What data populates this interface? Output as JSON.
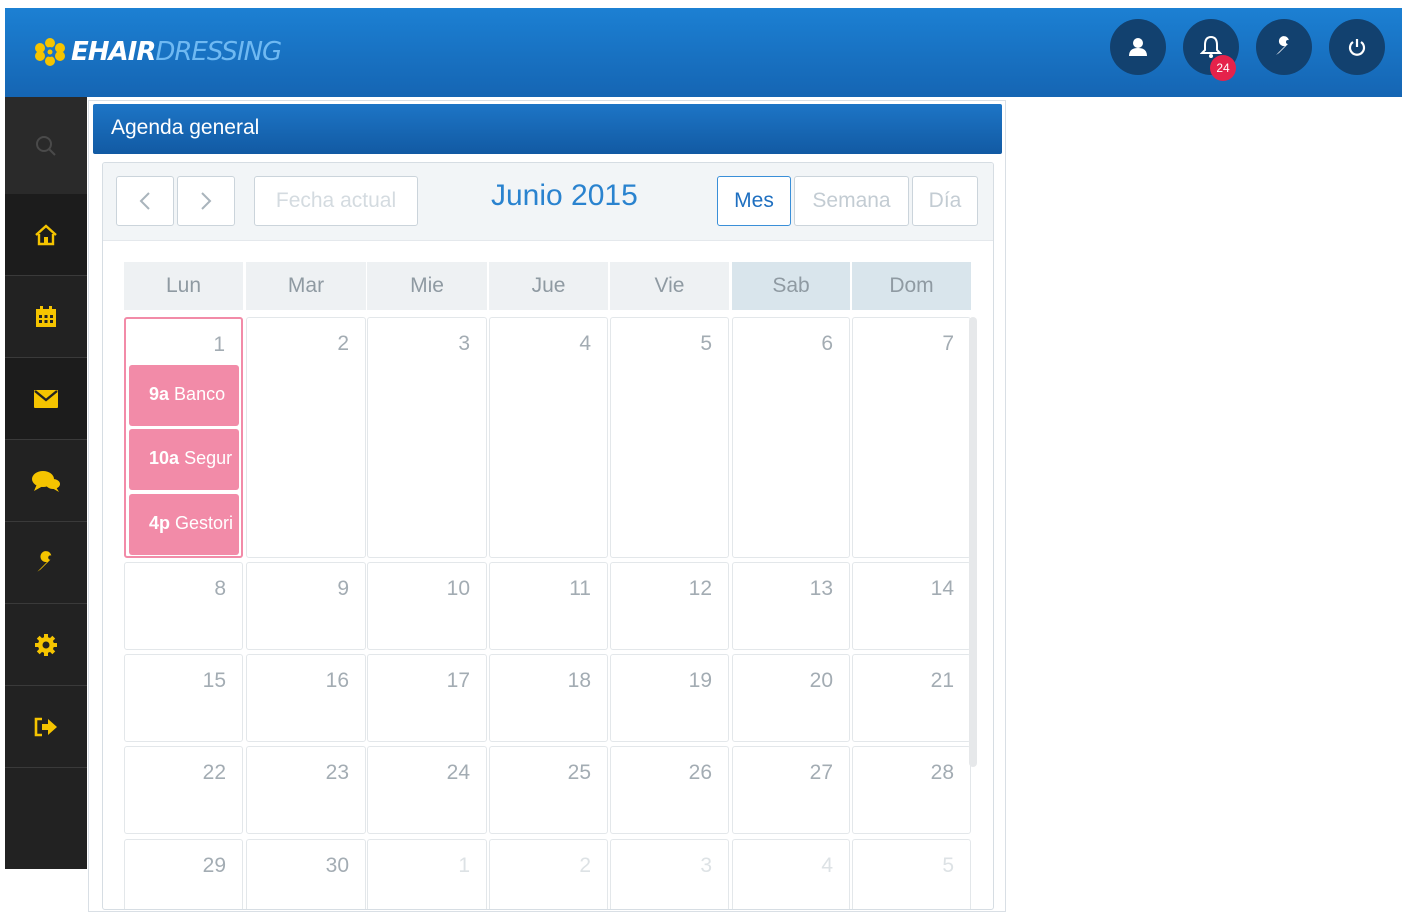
{
  "brand": {
    "part1": "EHAIR",
    "part2": "DRESSING",
    "mark_color": "#f5c400"
  },
  "header": {
    "icons": [
      {
        "name": "user-icon"
      },
      {
        "name": "bell-icon",
        "badge": "24"
      },
      {
        "name": "wrench-icon"
      },
      {
        "name": "power-icon"
      }
    ]
  },
  "sidebar": {
    "items": [
      {
        "name": "home-icon"
      },
      {
        "name": "calendar-icon"
      },
      {
        "name": "envelope-icon"
      },
      {
        "name": "chat-icon"
      },
      {
        "name": "wrench-icon"
      },
      {
        "name": "cog-icon"
      },
      {
        "name": "logout-icon"
      }
    ],
    "icon_color": "#f5c400"
  },
  "panel": {
    "title": "Agenda general"
  },
  "calendar": {
    "buttons": {
      "prev": "‹",
      "next": "›",
      "today": "Fecha actual",
      "month": "Mes",
      "week": "Semana",
      "day": "Día"
    },
    "title": "Junio 2015",
    "weekdays": [
      "Lun",
      "Mar",
      "Mie",
      "Jue",
      "Vie",
      "Sab",
      "Dom"
    ],
    "weeks": [
      [
        "1",
        "2",
        "3",
        "4",
        "5",
        "6",
        "7"
      ],
      [
        "8",
        "9",
        "10",
        "11",
        "12",
        "13",
        "14"
      ],
      [
        "15",
        "16",
        "17",
        "18",
        "19",
        "20",
        "21"
      ],
      [
        "22",
        "23",
        "24",
        "25",
        "26",
        "27",
        "28"
      ],
      [
        "29",
        "30",
        "1",
        "2",
        "3",
        "4",
        "5"
      ]
    ],
    "events": [
      {
        "time": "9a",
        "title": "Banco"
      },
      {
        "time": "10a",
        "title": "Segur"
      },
      {
        "time": "4p",
        "title": "Gestori"
      }
    ],
    "event_color": "#f28ba8"
  }
}
